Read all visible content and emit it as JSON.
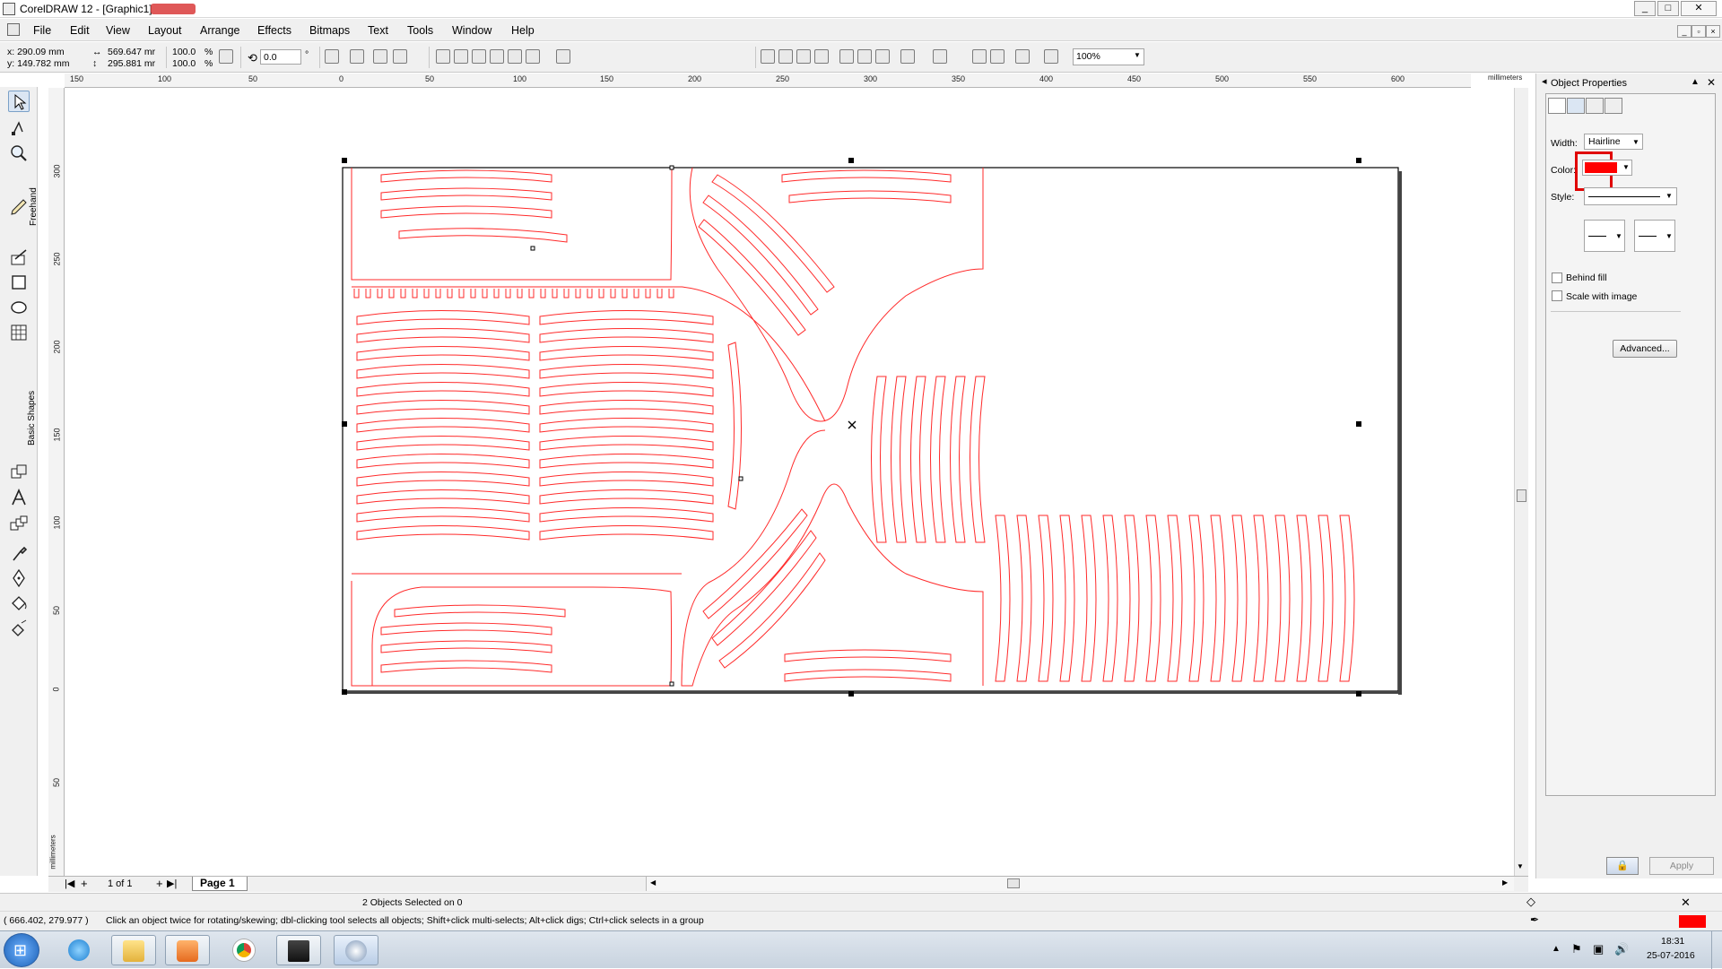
{
  "window": {
    "title": "CorelDRAW 12 - [Graphic1]",
    "controls": [
      "_",
      "□",
      "✕"
    ]
  },
  "menu": [
    "File",
    "Edit",
    "View",
    "Layout",
    "Arrange",
    "Effects",
    "Bitmaps",
    "Text",
    "Tools",
    "Window",
    "Help"
  ],
  "propbar": {
    "x": "x: 290.09 mm",
    "y": "y: 149.782 mm",
    "width": "569.647 mr",
    "height": "295.881 mr",
    "scale_x": "100.0",
    "scale_y": "100.0",
    "pct": "%",
    "rotation": "0.0",
    "degree": "°",
    "zoom": "100%"
  },
  "ruler": {
    "h_labels": [
      "150",
      "100",
      "50",
      "0",
      "50",
      "100",
      "150",
      "200",
      "250",
      "300",
      "350",
      "400",
      "450",
      "500",
      "550",
      "600"
    ],
    "h_unit": "millimeters",
    "v_labels": [
      "300",
      "250",
      "200",
      "150",
      "100",
      "50",
      "0",
      "50"
    ],
    "v_unit": "millimeters"
  },
  "toolbox": {
    "freehand_label": "Freehand",
    "basic_shapes_label": "Basic Shapes"
  },
  "pagebar": {
    "page_count": "1 of 1",
    "page_tab": "Page 1"
  },
  "status": {
    "selection": "2 Objects Selected on 0",
    "coords": "( 666.402, 279.977 )",
    "hint": "Click an object twice for rotating/skewing; dbl-clicking tool selects all objects; Shift+click multi-selects; Alt+click digs; Ctrl+click selects in a group"
  },
  "docker": {
    "title": "Object Properties",
    "width_label": "Width:",
    "width_value": "Hairline",
    "color_label": "Color:",
    "style_label": "Style:",
    "behind_fill": "Behind fill",
    "scale_with_image": "Scale with image",
    "advanced_button": "Advanced...",
    "apply_button": "Apply"
  },
  "colors": {
    "outline": "#ff0000",
    "accent_highlight": "#e00000",
    "page_border": "#000000"
  },
  "taskbar": {
    "time": "18:31",
    "date": "25-07-2016"
  }
}
